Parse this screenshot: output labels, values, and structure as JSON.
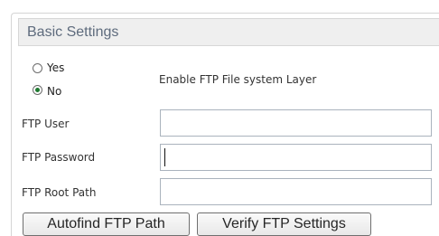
{
  "panel": {
    "title": "Basic Settings"
  },
  "ftp_layer": {
    "options": [
      {
        "label": "Yes",
        "selected": false
      },
      {
        "label": "No",
        "selected": true
      }
    ],
    "description": "Enable FTP File system Layer"
  },
  "fields": {
    "ftp_user": {
      "label": "FTP User",
      "value": "",
      "placeholder": ""
    },
    "ftp_password": {
      "label": "FTP Password",
      "value": "",
      "placeholder": ""
    },
    "ftp_root_path": {
      "label": "FTP Root Path",
      "value": "",
      "placeholder": ""
    }
  },
  "buttons": {
    "autofind_label": "Autofind FTP Path",
    "verify_label": "Verify FTP Settings"
  },
  "colors": {
    "header_background": "#efefef",
    "header_text": "#5e6b7d",
    "radio_selected": "#1f7a31",
    "input_border": "#aab3bd"
  },
  "icons": {
    "radio_unselected": "radio-unselected-icon",
    "radio_selected": "radio-selected-icon"
  }
}
